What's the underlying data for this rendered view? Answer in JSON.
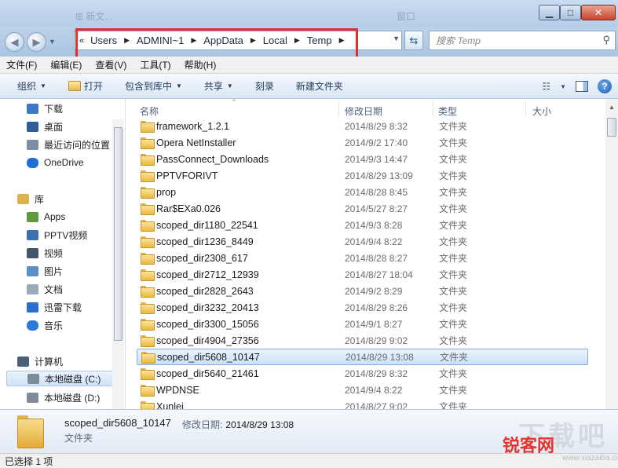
{
  "window": {
    "ghost_left": "⊞ 新文...",
    "ghost_right": "窗口",
    "min_glyph": "▁",
    "max_glyph": "□",
    "close_glyph": "✕"
  },
  "nav": {
    "back_glyph": "◀",
    "forward_glyph": "▶",
    "refresh_glyph": "⇆",
    "dropdown_glyph": "▼",
    "breadcrumb_chevron": "«",
    "breadcrumb": [
      "Users",
      "ADMINI~1",
      "AppData",
      "Local",
      "Temp"
    ],
    "breadcrumb_sep": "▶",
    "search_placeholder": "搜索 Temp",
    "search_glyph": "⚲"
  },
  "menu": [
    "文件(F)",
    "编辑(E)",
    "查看(V)",
    "工具(T)",
    "帮助(H)"
  ],
  "toolbar": {
    "organize": "组织",
    "open": "打开",
    "include": "包含到库中",
    "share": "共享",
    "burn": "刻录",
    "new_folder": "新建文件夹",
    "dd": "▼",
    "view_glyph": "☷",
    "help_glyph": "?"
  },
  "navpane": {
    "favorites": [
      {
        "label": "下载",
        "color": "#3d78c9"
      },
      {
        "label": "桌面",
        "color": "#2f5c9a"
      },
      {
        "label": "最近访问的位置",
        "color": "#7d8ea4"
      },
      {
        "label": "OneDrive",
        "color": "#1f6fd1"
      }
    ],
    "library_head": "库",
    "library": [
      {
        "label": "Apps",
        "color": "#5e9a3b"
      },
      {
        "label": "PPTV视频",
        "color": "#3e6fae"
      },
      {
        "label": "视频",
        "color": "#44556b"
      },
      {
        "label": "图片",
        "color": "#5d8fc7"
      },
      {
        "label": "文档",
        "color": "#9aa9bb"
      },
      {
        "label": "迅雷下载",
        "color": "#2d6fd0"
      },
      {
        "label": "音乐",
        "color": "#2d79d6"
      }
    ],
    "computer_head": "计算机",
    "drives": [
      {
        "label": "本地磁盘 (C:)",
        "color": "#7e8b99"
      },
      {
        "label": "本地磁盘 (D:)",
        "color": "#7e8b99"
      }
    ]
  },
  "columns": {
    "name": "名称",
    "date": "修改日期",
    "type": "类型",
    "size": "大小",
    "sort_glyph": "^"
  },
  "files": [
    {
      "name": "framework_1.2.1",
      "date": "2014/8/29 8:32",
      "type": "文件夹"
    },
    {
      "name": "Opera NetInstaller",
      "date": "2014/9/2 17:40",
      "type": "文件夹"
    },
    {
      "name": "PassConnect_Downloads",
      "date": "2014/9/3 14:47",
      "type": "文件夹"
    },
    {
      "name": "PPTVFORIVT",
      "date": "2014/8/29 13:09",
      "type": "文件夹"
    },
    {
      "name": "prop",
      "date": "2014/8/28 8:45",
      "type": "文件夹"
    },
    {
      "name": "Rar$EXa0.026",
      "date": "2014/5/27 8:27",
      "type": "文件夹"
    },
    {
      "name": "scoped_dir1180_22541",
      "date": "2014/9/3 8:28",
      "type": "文件夹"
    },
    {
      "name": "scoped_dir1236_8449",
      "date": "2014/9/4 8:22",
      "type": "文件夹"
    },
    {
      "name": "scoped_dir2308_617",
      "date": "2014/8/28 8:27",
      "type": "文件夹"
    },
    {
      "name": "scoped_dir2712_12939",
      "date": "2014/8/27 18:04",
      "type": "文件夹"
    },
    {
      "name": "scoped_dir2828_2643",
      "date": "2014/9/2 8:29",
      "type": "文件夹"
    },
    {
      "name": "scoped_dir3232_20413",
      "date": "2014/8/29 8:26",
      "type": "文件夹"
    },
    {
      "name": "scoped_dir3300_15056",
      "date": "2014/9/1 8:27",
      "type": "文件夹"
    },
    {
      "name": "scoped_dir4904_27356",
      "date": "2014/8/29 9:02",
      "type": "文件夹"
    },
    {
      "name": "scoped_dir5608_10147",
      "date": "2014/8/29 13:08",
      "type": "文件夹",
      "selected": true
    },
    {
      "name": "scoped_dir5640_21461",
      "date": "2014/8/29 8:32",
      "type": "文件夹"
    },
    {
      "name": "WPDNSE",
      "date": "2014/9/4 8:22",
      "type": "文件夹"
    },
    {
      "name": "Xunlei",
      "date": "2014/8/27 9:02",
      "type": "文件夹"
    }
  ],
  "details": {
    "name": "scoped_dir5608_10147",
    "modified_label": "修改日期:",
    "modified_value": "2014/8/29 13:08",
    "type": "文件夹"
  },
  "status": "已选择 1 项",
  "watermark": {
    "big": "下载吧",
    "logo": "锐客网",
    "url": "www.xiazaiba.com"
  }
}
